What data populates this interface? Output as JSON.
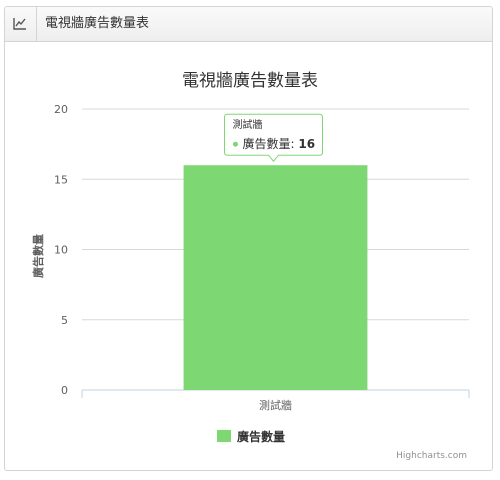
{
  "widget": {
    "title": "電視牆廣告數量表",
    "icon": "line-chart-icon"
  },
  "colors": {
    "bar": "#7dd873",
    "grid": "#d8d8d8",
    "axis_line": "#c0d0e0",
    "tooltip_border": "#7dd873"
  },
  "chart_data": {
    "type": "bar",
    "title": "電視牆廣告數量表",
    "categories": [
      "測試牆"
    ],
    "series": [
      {
        "name": "廣告數量",
        "values": [
          16
        ]
      }
    ],
    "ylabel": "廣告數量",
    "xlabel": "",
    "ylim": [
      0,
      20
    ],
    "yticks": [
      "0",
      "5",
      "10",
      "15",
      "20"
    ],
    "grid": true,
    "legend": "bottom-center",
    "tooltip": {
      "header": "測試牆",
      "series": "廣告數量",
      "value": "16"
    },
    "credits": "Highcharts.com"
  }
}
